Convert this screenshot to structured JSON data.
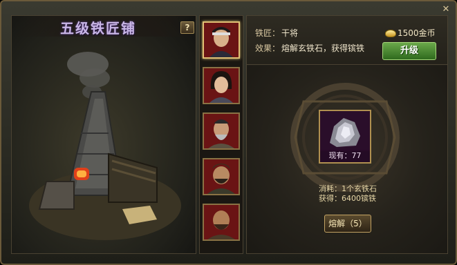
{
  "window": {
    "close_glyph": "✕"
  },
  "building": {
    "title": "五级铁匠铺",
    "help_label": "?"
  },
  "blacksmith": {
    "smith_label": "铁匠：",
    "smith_name": "干将",
    "effect_label": "效果：",
    "effect_text": "熔解玄铁石，获得镔铁"
  },
  "upgrade": {
    "cost_text": "1500金币",
    "button_label": "升级"
  },
  "forge": {
    "have_text": "现有：77",
    "consume_text": "消耗：1个玄铁石",
    "gain_text": "获得：6400镔铁",
    "melt_label": "熔解（5）"
  },
  "portraits": [
    {
      "name": "portrait-1",
      "active": true
    },
    {
      "name": "portrait-2",
      "active": false
    },
    {
      "name": "portrait-3",
      "active": false
    },
    {
      "name": "portrait-4",
      "active": false
    },
    {
      "name": "portrait-5",
      "active": false
    }
  ],
  "colors": {
    "title": "#c9b6e6",
    "accent_gold": "#b09050",
    "upgrade_green": "#4a8a30"
  }
}
